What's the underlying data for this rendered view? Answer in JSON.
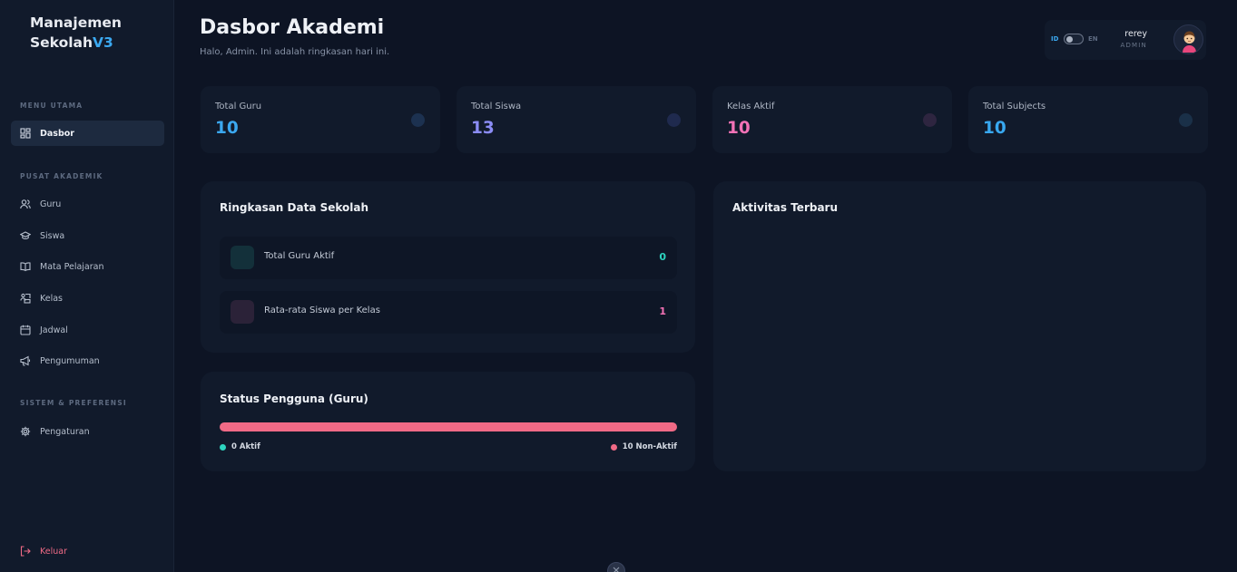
{
  "brand": {
    "line1": "Manajemen",
    "line2": "Sekolah",
    "version": "V3"
  },
  "sidebar": {
    "sections": {
      "main": "MENU UTAMA",
      "academic": "PUSAT AKADEMIK",
      "system": "SISTEM & PREFERENSI"
    },
    "items": [
      {
        "label": "Dasbor",
        "icon": "dashboard-icon"
      },
      {
        "label": "Guru",
        "icon": "users-icon"
      },
      {
        "label": "Siswa",
        "icon": "graduation-cap-icon"
      },
      {
        "label": "Mata Pelajaran",
        "icon": "book-icon"
      },
      {
        "label": "Kelas",
        "icon": "classroom-icon"
      },
      {
        "label": "Jadwal",
        "icon": "calendar-icon"
      },
      {
        "label": "Pengumuman",
        "icon": "megaphone-icon"
      },
      {
        "label": "Pengaturan",
        "icon": "gear-icon"
      }
    ],
    "logout": "Keluar"
  },
  "header": {
    "title": "Dasbor Akademi",
    "subtitle": "Halo, Admin. Ini adalah ringkasan hari ini."
  },
  "user": {
    "lang_id": "ID",
    "lang_en": "EN",
    "name": "rerey",
    "role": "ADMIN"
  },
  "stats": [
    {
      "label": "Total Guru",
      "value": "10",
      "color": "#3ba8f0"
    },
    {
      "label": "Total Siswa",
      "value": "13",
      "color": "#8b8cf5"
    },
    {
      "label": "Kelas Aktif",
      "value": "10",
      "color": "#f472b6"
    },
    {
      "label": "Total Subjects",
      "value": "10",
      "color": "#38a8f0"
    }
  ],
  "summary": {
    "title": "Ringkasan Data Sekolah",
    "rows": [
      {
        "label": "Total Guru Aktif",
        "value": "0",
        "color": "#2dd4bf"
      },
      {
        "label": "Rata-rata Siswa per Kelas",
        "value": "1",
        "color": "#f472b6"
      }
    ]
  },
  "user_status": {
    "title": "Status Pengguna (Guru)",
    "active_label": "0 Aktif",
    "inactive_label": "10 Non-Aktif",
    "active_fraction": 0,
    "active_color": "#2dd4bf",
    "inactive_color": "#f06a86"
  },
  "activity": {
    "title": "Aktivitas Terbaru"
  }
}
